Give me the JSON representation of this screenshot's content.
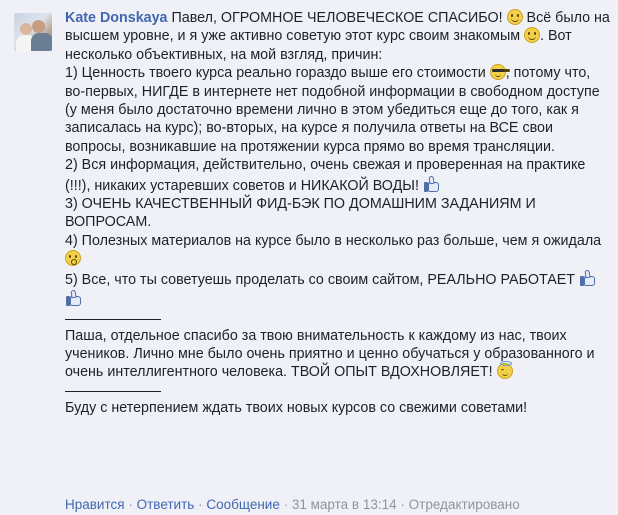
{
  "author": {
    "name": "Kate Donskaya"
  },
  "comment": {
    "intro_1": "Павел, ОГРОМНОЕ ЧЕЛОВЕЧЕСКОЕ СПАСИБО!",
    "intro_2": "Всё было на высшем уровне, и я уже активно советую этот курс своим знакомым",
    "intro_3": ". Вот несколько объективных, на мой взгляд, причин:",
    "point1_a": "1) Ценность твоего курса реально гораздо выше его стоимости",
    "point1_b": ", потому что, во-первых, НИГДЕ в интернете нет подобной информации в свободном доступе (у меня было достаточно времени лично в этом убедиться еще до того, как я записалась на курс); во-вторых, на курсе я получила ответы на ВСЕ свои вопросы, возникавшие на протяжении курса прямо во время трансляции.",
    "point2": "2) Вся информация, действительно, очень свежая и проверенная на практике (!!!), никаких устаревших советов и НИКАКОЙ ВОДЫ!",
    "point3": "3) ОЧЕНЬ КАЧЕСТВЕННЫЙ ФИД-БЭК ПО ДОМАШНИМ ЗАДАНИЯМ И ВОПРОСАМ.",
    "point4": "4) Полезных материалов на курсе было в несколько раз больше, чем я ожидала",
    "point5": "5) Все, что ты советуешь проделать со своим сайтом, РЕАЛЬНО РАБОТАЕТ",
    "para2": "Паша, отдельное спасибо за твою внимательность к каждому из нас, твоих учеников. Лично мне было очень приятно и ценно обучаться у образованного и очень интеллигентного человека. ТВОЙ ОПЫТ ВДОХНОВЛЯЕТ!",
    "para3": "Буду с нетерпением ждать твоих новых курсов со свежими советами!"
  },
  "actions": {
    "respect": "Нравится",
    "reply": "Ответить",
    "message": "Сообщение",
    "timestamp": "31 марта в 13:14",
    "edited": "Отредактировано",
    "separator": "·"
  },
  "icons": {
    "emoji_smile": "smiling-face-icon",
    "emoji_cool": "sunglasses-face-icon",
    "emoji_surprised": "surprised-face-icon",
    "emoji_angel": "angel-face-icon",
    "like": "thumbs-up-icon"
  },
  "colors": {
    "background": "#eff1f6",
    "link": "#4267b2",
    "text": "#1d2129",
    "meta": "#90949c"
  }
}
